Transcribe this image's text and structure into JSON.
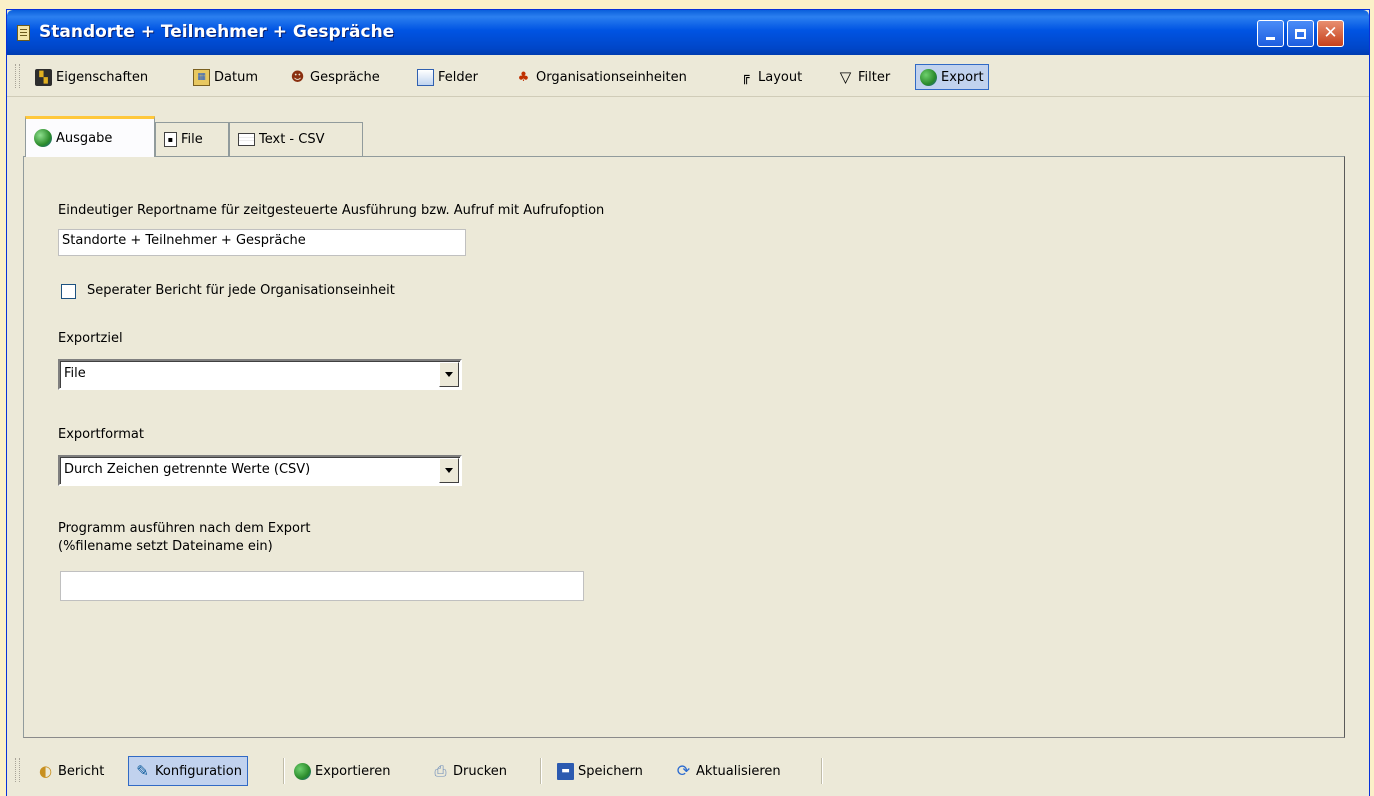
{
  "window": {
    "title": "Standorte + Teilnehmer + Gespräche"
  },
  "toolbar": {
    "items": [
      {
        "label": "Eigenschaften",
        "icon": "properties-icon"
      },
      {
        "label": "Datum",
        "icon": "calendar-icon"
      },
      {
        "label": "Gespräche",
        "icon": "conversations-icon"
      },
      {
        "label": "Felder",
        "icon": "fields-icon"
      },
      {
        "label": "Organisationseinheiten",
        "icon": "org-units-icon"
      },
      {
        "label": "Layout",
        "icon": "layout-icon"
      },
      {
        "label": "Filter",
        "icon": "filter-icon"
      },
      {
        "label": "Export",
        "icon": "export-globe-icon",
        "active": true
      }
    ]
  },
  "tabs": [
    {
      "label": "Ausgabe",
      "active": true
    },
    {
      "label": "File"
    },
    {
      "label": "Text - CSV"
    }
  ],
  "form": {
    "reportname_label": "Eindeutiger Reportname für zeitgesteuerte Ausführung bzw. Aufruf mit Aufrufoption",
    "reportname_value": "Standorte + Teilnehmer + Gespräche",
    "separate_report_label": "Seperater Bericht für jede Organisationseinheit",
    "separate_report_checked": false,
    "exportziel_label": "Exportziel",
    "exportziel_value": "File",
    "exportformat_label": "Exportformat",
    "exportformat_value": "Durch Zeichen getrennte Werte (CSV)",
    "program_label_line1": "Programm ausführen nach dem Export",
    "program_label_line2": "(%filename setzt Dateiname ein)",
    "program_value": ""
  },
  "bottombar": {
    "items": [
      {
        "label": "Bericht",
        "icon": "report-icon"
      },
      {
        "label": "Konfiguration",
        "icon": "configuration-icon",
        "active": true
      },
      {
        "label": "Exportieren",
        "icon": "export-globe-icon"
      },
      {
        "label": "Drucken",
        "icon": "print-icon"
      },
      {
        "label": "Speichern",
        "icon": "save-icon"
      },
      {
        "label": "Aktualisieren",
        "icon": "refresh-icon"
      }
    ]
  }
}
